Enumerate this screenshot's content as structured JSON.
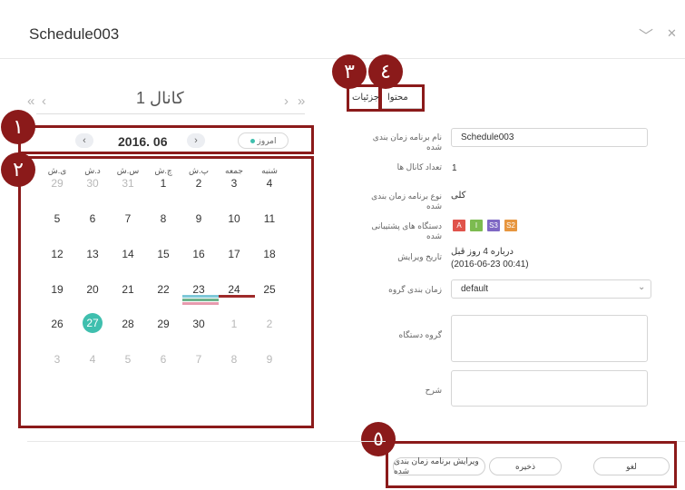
{
  "window": {
    "title": "Schedule003",
    "minimize_glyph": "﹀",
    "close_glyph": "✕"
  },
  "calendar": {
    "nav_first": "«",
    "nav_prev": "‹",
    "nav_next": "›",
    "nav_last": "»",
    "channel_label": "كانال 1",
    "month_prev": "‹",
    "month_next": "›",
    "month_label": "2016. 06",
    "today_label": "امروز",
    "weekdays": [
      "ی.ش",
      "د.ش",
      "س.ش",
      "چ.ش",
      "پ.ش",
      "جمعه",
      "شنبه"
    ],
    "weeks": [
      [
        "29",
        "30",
        "31",
        "1",
        "2",
        "3",
        "4"
      ],
      [
        "5",
        "6",
        "7",
        "8",
        "9",
        "10",
        "11"
      ],
      [
        "12",
        "13",
        "14",
        "15",
        "16",
        "17",
        "18"
      ],
      [
        "19",
        "20",
        "21",
        "22",
        "23",
        "24",
        "25"
      ],
      [
        "26",
        "27",
        "28",
        "29",
        "30",
        "1",
        "2"
      ],
      [
        "3",
        "4",
        "5",
        "6",
        "7",
        "8",
        "9"
      ]
    ],
    "today": "27",
    "colors": {
      "today": "#3fbfae",
      "bar_teal": "#7ec8d8",
      "bar_green": "#6db38c",
      "bar_pink": "#e79aae",
      "bar_red": "#9e2a2a"
    }
  },
  "badges": {
    "b1": "١",
    "b2": "٢",
    "b3": "٣",
    "b4": "٤",
    "b5": "٥"
  },
  "tabs": {
    "details": "جزئيات",
    "content": "محتوا"
  },
  "details": {
    "name_label": "نام برنامه زمان بندی شده",
    "name_value": "Schedule003",
    "channels_label": "تعداد کانال ها",
    "channels_value": "1",
    "type_label": "نوع برنامه زمان بندی شده",
    "type_value": "کلی",
    "devices_label": "دستگاه های پشتیبانی شده",
    "devices": [
      {
        "text": "A",
        "color": "#e0534b"
      },
      {
        "text": "I",
        "color": "#7cbb50"
      },
      {
        "text": "S3",
        "color": "#7f68c4"
      },
      {
        "text": "S2",
        "color": "#e7963f"
      }
    ],
    "edited_label": "تاریخ ویرایش",
    "edited_value_line1": "درباره 4 روز قبل",
    "edited_value_line2": "(2016-06-23 00:41)",
    "group_schedule_label": "زمان بندی گروه",
    "group_schedule_value": "default",
    "group_schedule_chevron": "⌄",
    "device_group_label": "گروه دستگاه",
    "description_label": "شرح"
  },
  "footer": {
    "edit_label": "ویرایش برنامه زمان بندی شده",
    "save_label": "ذخیره",
    "cancel_label": "لغو"
  }
}
